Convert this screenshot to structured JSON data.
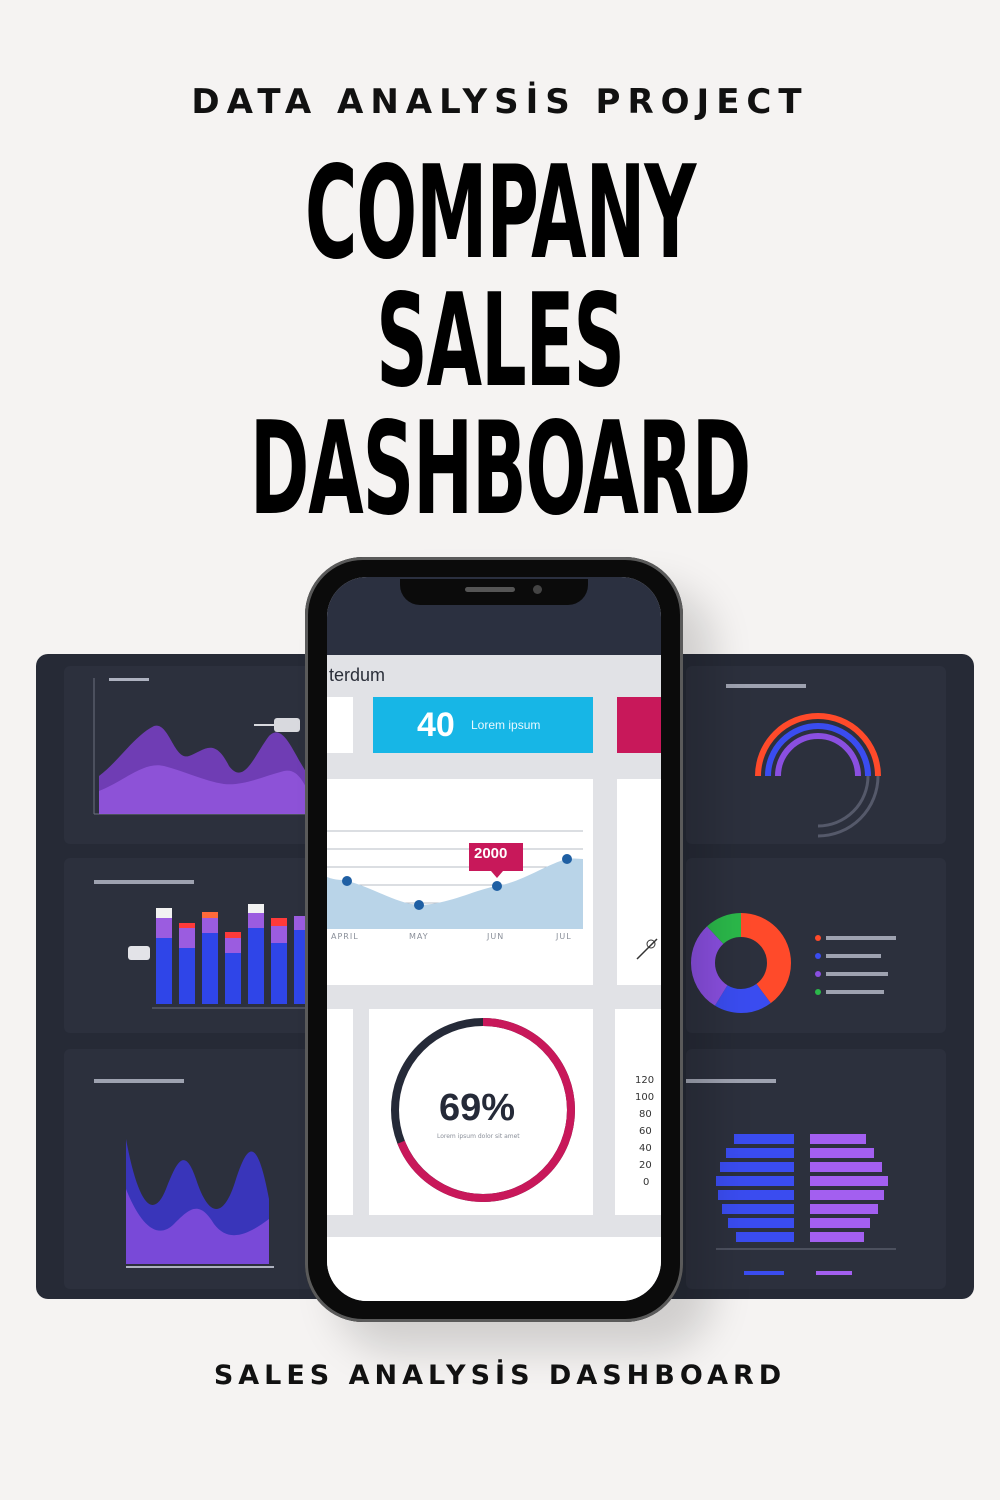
{
  "header": {
    "kicker": "DATA ANALYSİS PROJECT",
    "title_line1": "COMPANY",
    "title_line2": "SALES",
    "title_line3": "DASHBOARD"
  },
  "footer": {
    "subtitle": "SALES ANALYSİS DASHBOARD"
  },
  "phone": {
    "screen_title": "terdum",
    "kpi_value": "40",
    "kpi_label": "Lorem ipsum",
    "line_chart": {
      "callout": "2000",
      "months": [
        "APRIL",
        "MAY",
        "JUN",
        "JUL"
      ]
    },
    "gauge": {
      "value": "69%",
      "percent": 69,
      "caption": "Lorem ipsum dolor sit amet"
    },
    "axis_ticks": [
      "120",
      "100",
      "80",
      "60",
      "40",
      "20",
      "0"
    ]
  },
  "colors": {
    "accent_blue": "#17b6e6",
    "accent_crimson": "#c8185a",
    "dark_board": "#262a36",
    "purple": "#8a4fe0",
    "royal_blue": "#3a4cf0"
  }
}
